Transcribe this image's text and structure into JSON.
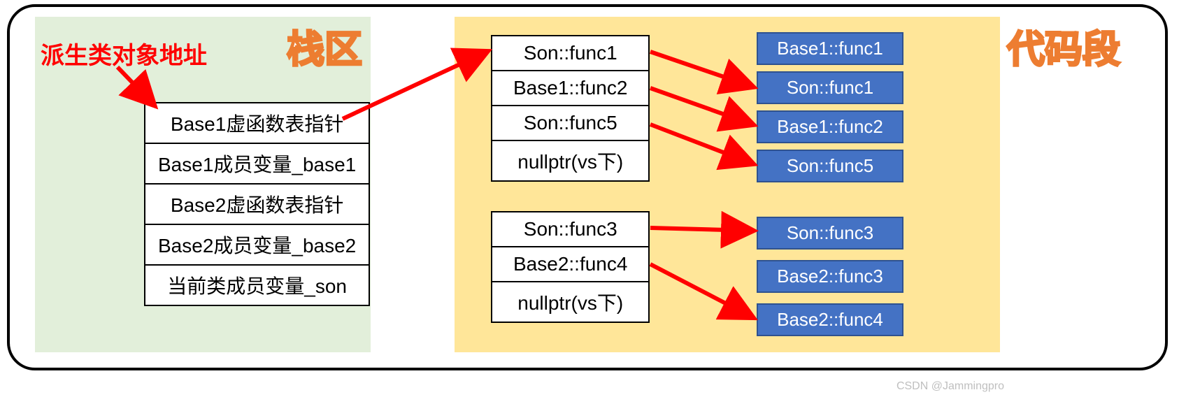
{
  "regions": {
    "stack_title": "栈区",
    "code_title": "代码段"
  },
  "labels": {
    "derived_addr": "派生类对象地址"
  },
  "object_layout": [
    "Base1虚函数表指针",
    "Base1成员变量_base1",
    "Base2虚函数表指针",
    "Base2成员变量_base2",
    "当前类成员变量_son"
  ],
  "vtable1": [
    "Son::func1",
    "Base1::func2",
    "Son::func5",
    "nullptr(vs下)"
  ],
  "vtable2": [
    "Son::func3",
    "Base2::func4",
    "nullptr(vs下)"
  ],
  "code_funcs_top": [
    "Base1::func1",
    "Son::func1",
    "Base1::func2",
    "Son::func5"
  ],
  "code_funcs_bottom": [
    "Son::func3",
    "Base2::func3",
    "Base2::func4"
  ],
  "watermark": "CSDN @Jammingpro"
}
